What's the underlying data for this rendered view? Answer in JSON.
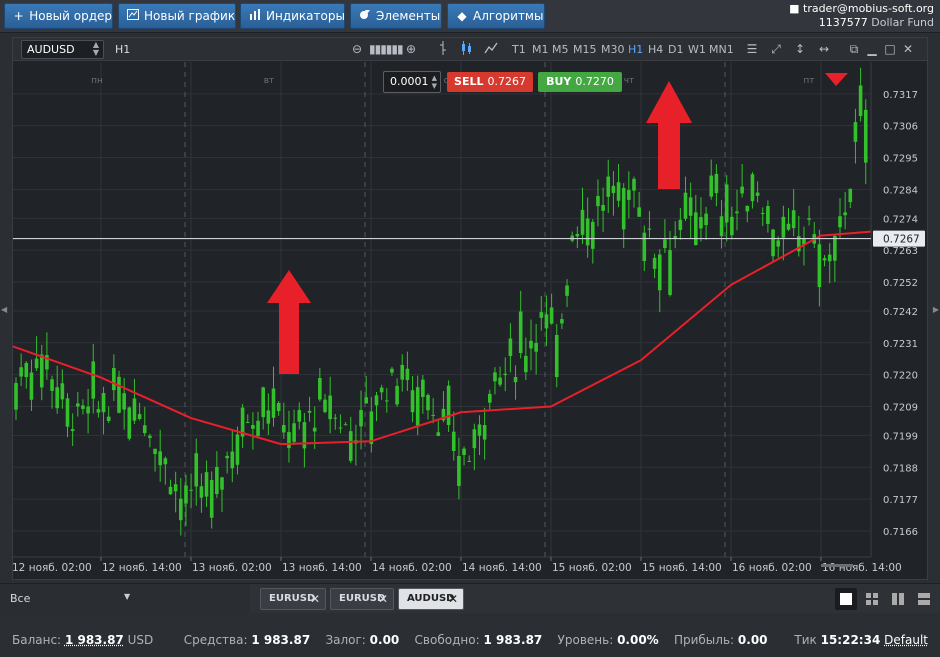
{
  "toolbar": {
    "new_order": "Новый ордер",
    "new_chart": "Новый график",
    "indicators": "Индикаторы",
    "elements": "Элементы",
    "algorithms": "Алгоритмы"
  },
  "account": {
    "email": "trader@mobius-soft.org",
    "number": "1137577",
    "fund": "Dollar Fund"
  },
  "chart": {
    "symbol": "AUDUSD",
    "timeframe": "H1",
    "timeframes": [
      "T1",
      "M1",
      "M5",
      "M15",
      "M30",
      "H1",
      "H4",
      "D1",
      "W1",
      "MN1"
    ],
    "active_timeframe": "H1",
    "pip_step": "0.0001",
    "sell_label": "SELL",
    "sell_price": "0.7267",
    "buy_label": "BUY",
    "buy_price": "0.7270",
    "current_price_label": "0.7267",
    "day_labels": [
      "пн",
      "вт",
      "ср",
      "чт",
      "пт"
    ]
  },
  "chart_data": {
    "type": "line",
    "title": "",
    "xlabel": "",
    "ylabel": "",
    "x": [
      "12 нояб. 02:00",
      "12 нояб. 14:00",
      "13 нояб. 02:00",
      "13 нояб. 14:00",
      "14 нояб. 02:00",
      "14 нояб. 14:00",
      "15 нояб. 02:00",
      "15 нояб. 14:00",
      "16 нояб. 02:00",
      "16 нояб. 14:00"
    ],
    "ylim": [
      0.7157,
      0.7328
    ],
    "y_ticks": [
      "0.7317",
      "0.7306",
      "0.7295",
      "0.7284",
      "0.7274",
      "0.7263",
      "0.7252",
      "0.7242",
      "0.7231",
      "0.7220",
      "0.7209",
      "0.7199",
      "0.7188",
      "0.7177",
      "0.7166"
    ],
    "series": [
      {
        "color": "#e8202a",
        "values": [
          0.723,
          0.7219,
          0.7205,
          0.7196,
          0.7197,
          0.7207,
          0.7209,
          0.7225,
          0.7251,
          0.7268
        ]
      }
    ],
    "current_price": 0.7267,
    "grid": true,
    "up_color": "#33c12b",
    "down_color": "#33c12b"
  },
  "tabs": {
    "filter_label": "Все",
    "items": [
      {
        "label": "EURUSD",
        "active": false
      },
      {
        "label": "EURUSD",
        "active": false
      },
      {
        "label": "AUDUSD",
        "active": true
      }
    ]
  },
  "status": {
    "balance_label": "Баланс:",
    "balance": "1 983.87",
    "currency": "USD",
    "equity_label": "Средства:",
    "equity": "1 983.87",
    "margin_label": "Залог:",
    "margin": "0.00",
    "free_label": "Свободно:",
    "free": "1 983.87",
    "level_label": "Уровень:",
    "level": "0.00%",
    "profit_label": "Прибыль:",
    "profit": "0.00",
    "tick_label": "Тик",
    "tick_time": "15:22:34",
    "tick_mode": "Default"
  }
}
